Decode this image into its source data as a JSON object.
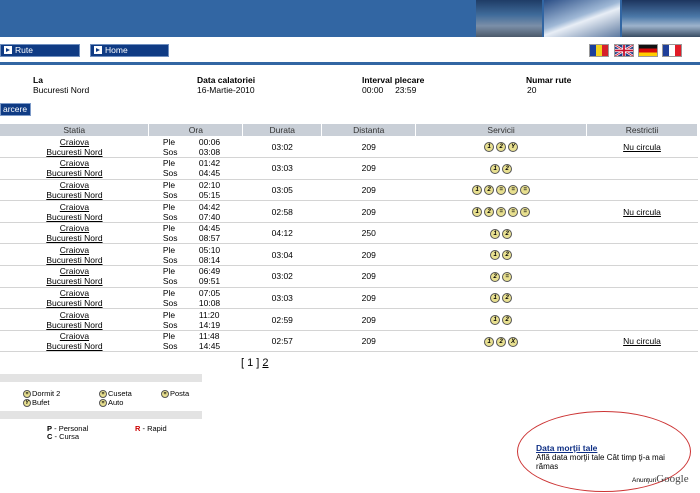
{
  "nav": {
    "rute": "Rute",
    "home": "Home"
  },
  "flags": [
    "romanian-flag",
    "uk-flag",
    "german-flag",
    "french-flag"
  ],
  "info": [
    {
      "label": "La",
      "value": "Bucuresti Nord"
    },
    {
      "label": "Data calatoriei",
      "value": "16-Martie-2010"
    },
    {
      "label": "Interval plecare",
      "value": "00:00     23:59"
    },
    {
      "label": "Numar rute",
      "value": "20"
    }
  ],
  "search_btn": "arcere",
  "headers": [
    "Statia",
    "Ora",
    "Durata",
    "Distanta",
    "Servicii",
    "Restrictii"
  ],
  "rows": [
    {
      "from": "Craiova",
      "to": "Bucuresti Nord",
      "ple": "00:06",
      "sos": "03:08",
      "durata": "03:02",
      "dist": "209",
      "svc": [
        "1",
        "2",
        "Y"
      ],
      "restr": "Nu circula"
    },
    {
      "from": "Craiova",
      "to": "Bucuresti Nord",
      "ple": "01:42",
      "sos": "04:45",
      "durata": "03:03",
      "dist": "209",
      "svc": [
        "1",
        "2"
      ],
      "restr": ""
    },
    {
      "from": "Craiova",
      "to": "Bucuresti Nord",
      "ple": "02:10",
      "sos": "05:15",
      "durata": "03:05",
      "dist": "209",
      "svc": [
        "1",
        "2",
        "=",
        "=",
        "="
      ],
      "restr": ""
    },
    {
      "from": "Craiova",
      "to": "Bucuresti Nord",
      "ple": "04:42",
      "sos": "07:40",
      "durata": "02:58",
      "dist": "209",
      "svc": [
        "1",
        "2",
        "=",
        "=",
        "="
      ],
      "restr": "Nu circula"
    },
    {
      "from": "Craiova",
      "to": "Bucuresti Nord",
      "ple": "04:45",
      "sos": "08:57",
      "durata": "04:12",
      "dist": "250",
      "svc": [
        "1",
        "2"
      ],
      "restr": ""
    },
    {
      "from": "Craiova",
      "to": "Bucuresti Nord",
      "ple": "05:10",
      "sos": "08:14",
      "durata": "03:04",
      "dist": "209",
      "svc": [
        "1",
        "2"
      ],
      "restr": ""
    },
    {
      "from": "Craiova",
      "to": "Bucuresti Nord",
      "ple": "06:49",
      "sos": "09:51",
      "durata": "03:02",
      "dist": "209",
      "svc": [
        "2",
        "="
      ],
      "restr": ""
    },
    {
      "from": "Craiova",
      "to": "Bucuresti Nord",
      "ple": "07:05",
      "sos": "10:08",
      "durata": "03:03",
      "dist": "209",
      "svc": [
        "1",
        "2"
      ],
      "restr": ""
    },
    {
      "from": "Craiova",
      "to": "Bucuresti Nord",
      "ple": "11:20",
      "sos": "14:19",
      "durata": "02:59",
      "dist": "209",
      "svc": [
        "1",
        "2"
      ],
      "restr": ""
    },
    {
      "from": "Craiova",
      "to": "Bucuresti Nord",
      "ple": "11:48",
      "sos": "14:45",
      "durata": "02:57",
      "dist": "209",
      "svc": [
        "1",
        "2",
        "X"
      ],
      "restr": "Nu circula"
    }
  ],
  "ple_label": "Ple",
  "sos_label": "Sos",
  "pagination": {
    "current": "[ 1 ]",
    "next": "2"
  },
  "legend": {
    "dormit": "Dormit 2",
    "cuseta": "Cuseta",
    "posta": "Posta",
    "bufet": "Bufet",
    "auto": "Auto"
  },
  "train_types": {
    "p_code": "P",
    "p_name": "- Personal",
    "r_code": "R",
    "r_name": "- Rapid",
    "c_code": "C",
    "c_name": "- Cursa"
  },
  "ad": {
    "title": "Data morţii tale",
    "text": "Află data morţii tale Cât timp ţi-a mai rămas",
    "anunturi": "Anunţuri",
    "google": "Google"
  }
}
